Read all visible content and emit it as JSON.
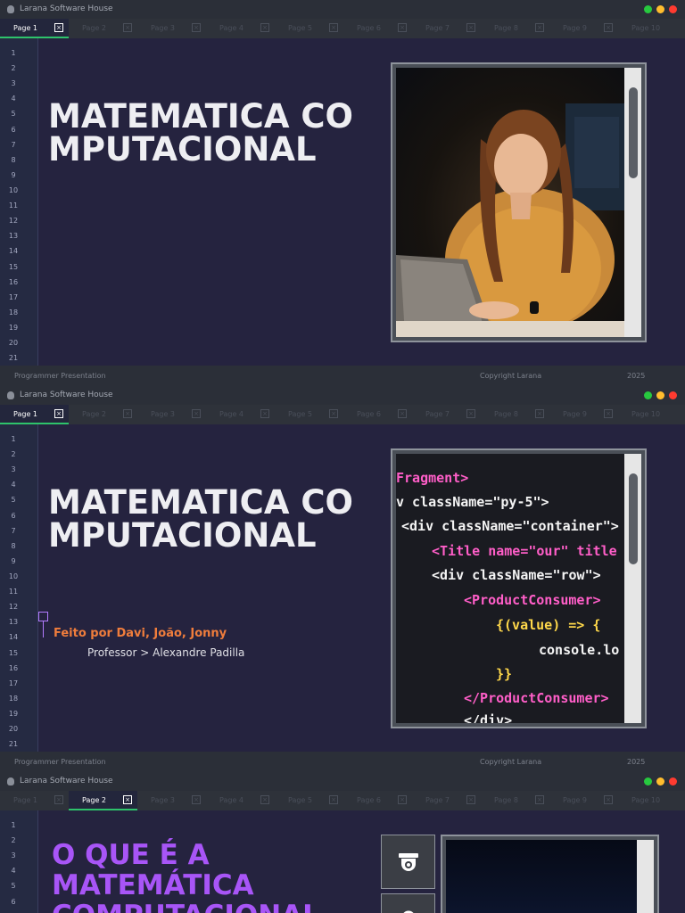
{
  "app": {
    "title": "Larana Software House"
  },
  "tabs": [
    "Page 1",
    "Page 2",
    "Page 3",
    "Page 4",
    "Page 5",
    "Page 6",
    "Page 7",
    "Page 8",
    "Page 9",
    "Page 10"
  ],
  "tab_close_glyph": "×",
  "footer": {
    "left": "Programmer Presentation",
    "middle": "Copyright Larana",
    "right": "2025"
  },
  "line_numbers": [
    "1",
    "2",
    "3",
    "4",
    "5",
    "6",
    "7",
    "8",
    "9",
    "10",
    "11",
    "12",
    "13",
    "14",
    "15",
    "16",
    "17",
    "18",
    "19",
    "20",
    "21"
  ],
  "slide1": {
    "title": "MATEMATICA COMPUTACIONAL",
    "active_tab": 0,
    "image": "woman-typing-on-laptop-photo"
  },
  "slide2": {
    "title": "MATEMATICA COMPUTACIONAL",
    "active_tab": 0,
    "subtitle": "Feito por Davi, João, Jonny",
    "professor": "Professor > Alexandre Padilla",
    "image": "code-editor-photo",
    "code_lines": [
      "Fragment>",
      "v className=\"py-5\">",
      "<div className=\"container\">",
      "<Title name=\"our\" title",
      "<div className=\"row\">",
      "<ProductConsumer>",
      "{(value) => {",
      "console.lo",
      "}}",
      "</ProductConsumer>",
      "</div>"
    ]
  },
  "slide3": {
    "title": "O QUE É A MATEMÁTICA COMPUTACIONAL",
    "active_tab": 1,
    "icons": [
      "security-camera-icon",
      "lock-icon"
    ]
  },
  "colors": {
    "accent_green": "#2ec36b",
    "title_purple": "#a855f7",
    "subtitle_orange": "#f07d3c",
    "background": "#25233f"
  }
}
